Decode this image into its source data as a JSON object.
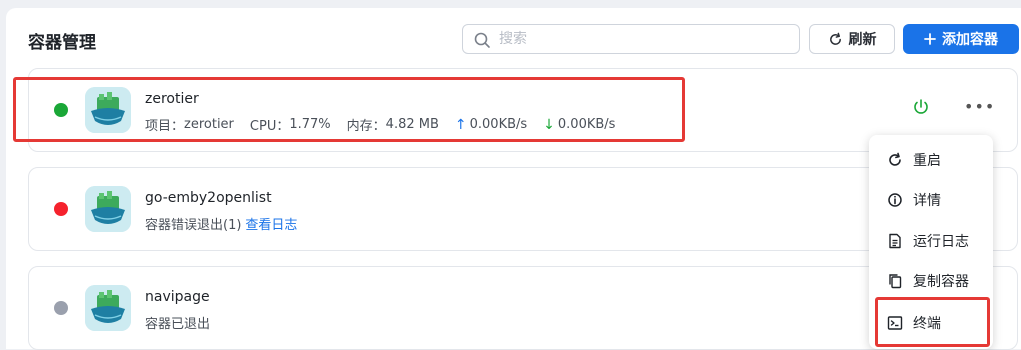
{
  "header": {
    "title": "容器管理",
    "search_placeholder": "搜索",
    "refresh_label": "刷新",
    "add_label": "添加容器"
  },
  "containers": [
    {
      "name": "zerotier",
      "status_color": "#1aa737",
      "project_label": "项目：",
      "project": "zerotier",
      "cpu_label": "CPU：",
      "cpu": "1.77%",
      "mem_label": "内存：",
      "mem": "4.82 MB",
      "up": "0.00KB/s",
      "down": "0.00KB/s"
    },
    {
      "name": "go-emby2openlist",
      "status_color": "#f5222d",
      "status_text": "容器错误退出(1)",
      "link_text": "查看日志"
    },
    {
      "name": "navipage",
      "status_color": "#9aa0ad",
      "status_text": "容器已退出"
    }
  ],
  "menu": {
    "items": [
      {
        "label": "重启",
        "icon": "restart-icon"
      },
      {
        "label": "详情",
        "icon": "info-icon"
      },
      {
        "label": "运行日志",
        "icon": "log-icon"
      },
      {
        "label": "复制容器",
        "icon": "copy-icon"
      },
      {
        "label": "终端",
        "icon": "terminal-icon"
      }
    ]
  },
  "colors": {
    "accent": "#1a73e8",
    "highlight": "#e53935",
    "running": "#1aa737",
    "error": "#f5222d",
    "stopped": "#9aa0ad"
  }
}
